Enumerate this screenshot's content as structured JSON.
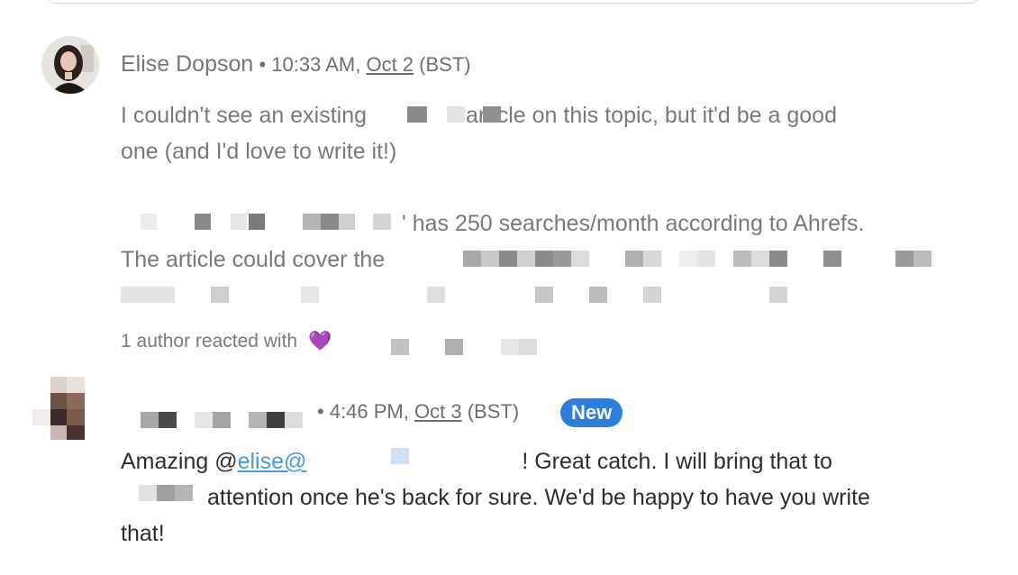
{
  "comments": [
    {
      "author": "Elise Dopson",
      "time": "10:33 AM,",
      "date": "Oct 2",
      "tz": "(BST)",
      "line1_a": "I couldn't see an existing",
      "line1_b": "article on this topic, but it'd be a good",
      "line2": "one (and I'd love to write it!)",
      "line3": "' has 250 searches/month according to Ahrefs.",
      "line4": "The article could cover the",
      "reaction_text": "1 author reacted with",
      "reaction_icon": "purple-heart-icon"
    },
    {
      "time": "4:46 PM,",
      "date": "Oct 3",
      "tz": "(BST)",
      "badge": "New",
      "line1_a": "Amazing @",
      "mention": "elise@",
      "line1_b": "! Great catch. I will bring that to",
      "line2": "attention once he's back for sure. We'd be happy to have you write",
      "line3": "that!"
    }
  ],
  "colors": {
    "badge": "#2e7ddc",
    "link": "#4a9ad6",
    "heart": "#a05ce0"
  }
}
